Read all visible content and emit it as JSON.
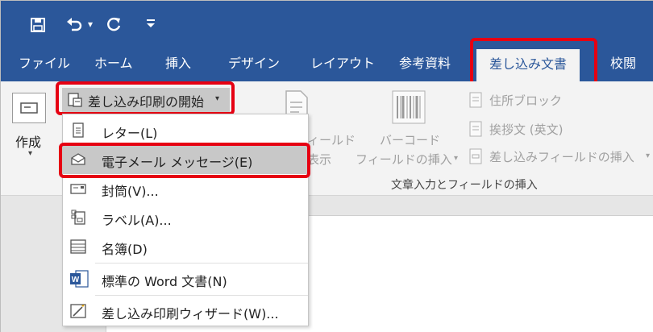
{
  "qat": {
    "save_icon": "save-icon",
    "undo_icon": "undo-icon",
    "undo_arrow": "▾",
    "redo_icon": "redo-icon",
    "customize": "₹"
  },
  "tabs": [
    {
      "label": "ファイル"
    },
    {
      "label": "ホーム"
    },
    {
      "label": "挿入"
    },
    {
      "label": "デザイン"
    },
    {
      "label": "レイアウト"
    },
    {
      "label": "参考資料"
    },
    {
      "label": "差し込み文書"
    },
    {
      "label": "校閲"
    }
  ],
  "ribbon": {
    "create_label": "作成",
    "create_arrow": "▾",
    "start_merge_label": "差し込み印刷の開始",
    "start_merge_arrow": "▾",
    "partial_field_line1": "ィールド",
    "partial_field_line2": "表示",
    "barcode_line1": "バーコード",
    "barcode_line2": "フィールドの挿入",
    "barcode_arrow": "▾",
    "address_block": "住所ブロック",
    "greeting_line": "挨拶文 (英文)",
    "insert_merge_field": "差し込みフィールドの挿入",
    "insert_merge_field_arrow": "▾",
    "group_label": "文章入力とフィールドの挿入"
  },
  "menu": {
    "items": [
      {
        "label": "レター(L)"
      },
      {
        "label": "電子メール メッセージ(E)"
      },
      {
        "label": "封筒(V)..."
      },
      {
        "label": "ラベル(A)..."
      },
      {
        "label": "名簿(D)"
      },
      {
        "label": "標準の Word 文書(N)"
      },
      {
        "label": "差し込み印刷ウィザード(W)..."
      }
    ]
  },
  "colors": {
    "title_bar": "#2b579a",
    "highlight_box": "#e60012",
    "word_icon": "#2b579a"
  }
}
